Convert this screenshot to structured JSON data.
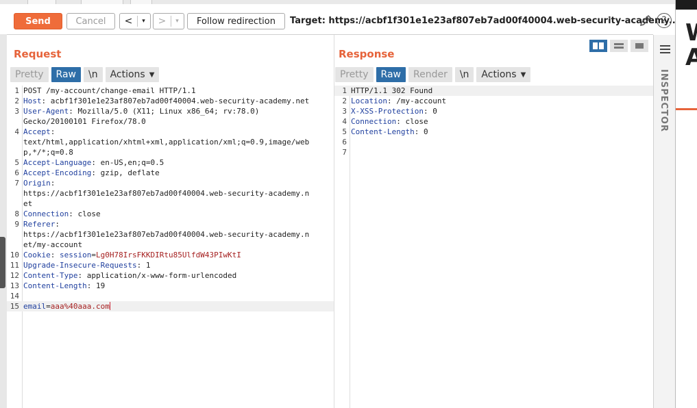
{
  "toolbar": {
    "send_label": "Send",
    "cancel_label": "Cancel",
    "back_label": "<",
    "forward_label": ">",
    "follow_label": "Follow redirection",
    "target_label": "Target: https://acbf1f301e1e23af807eb7ad00f40004.web-security-academy...."
  },
  "request": {
    "title": "Request",
    "tabs": [
      "Pretty",
      "Raw",
      "\\n",
      "Actions"
    ],
    "active_tab": "Raw",
    "lines": [
      {
        "n": "1",
        "key": "",
        "val": "POST /my-account/change-email HTTP/1.1"
      },
      {
        "n": "2",
        "key": "Host",
        "val": "acbf1f301e1e23af807eb7ad00f40004.web-security-academy.net"
      },
      {
        "n": "3",
        "key": "User-Agent",
        "val": "Mozilla/5.0 (X11; Linux x86_64; rv:78.0)"
      },
      {
        "n": "",
        "key": "",
        "val": "Gecko/20100101 Firefox/78.0"
      },
      {
        "n": "4",
        "key": "Accept",
        "val": ""
      },
      {
        "n": "",
        "key": "",
        "val": "text/html,application/xhtml+xml,application/xml;q=0.9,image/web"
      },
      {
        "n": "",
        "key": "",
        "val": "p,*/*;q=0.8"
      },
      {
        "n": "5",
        "key": "Accept-Language",
        "val": "en-US,en;q=0.5"
      },
      {
        "n": "6",
        "key": "Accept-Encoding",
        "val": "gzip, deflate"
      },
      {
        "n": "7",
        "key": "Origin",
        "val": ""
      },
      {
        "n": "",
        "key": "",
        "val": "https://acbf1f301e1e23af807eb7ad00f40004.web-security-academy.n"
      },
      {
        "n": "",
        "key": "",
        "val": "et"
      },
      {
        "n": "8",
        "key": "Connection",
        "val": "close"
      },
      {
        "n": "9",
        "key": "Referer",
        "val": ""
      },
      {
        "n": "",
        "key": "",
        "val": "https://acbf1f301e1e23af807eb7ad00f40004.web-security-academy.n"
      },
      {
        "n": "",
        "key": "",
        "val": "et/my-account"
      },
      {
        "n": "10",
        "key": "Cookie",
        "val": "",
        "cookie_name": "session",
        "cookie_val": "Lg0H78IrsFKKDIRtu85UlfdW43PIwKtI"
      },
      {
        "n": "11",
        "key": "Upgrade-Insecure-Requests",
        "val": "1"
      },
      {
        "n": "12",
        "key": "Content-Type",
        "val": "application/x-www-form-urlencoded"
      },
      {
        "n": "13",
        "key": "Content-Length",
        "val": "19"
      },
      {
        "n": "14",
        "key": "",
        "val": ""
      },
      {
        "n": "15",
        "key": "",
        "val": "",
        "param_name": "email",
        "param_val": "aaa%40aaa.com"
      }
    ]
  },
  "response": {
    "title": "Response",
    "tabs": [
      "Pretty",
      "Raw",
      "Render",
      "\\n",
      "Actions"
    ],
    "active_tab": "Raw",
    "lines": [
      {
        "n": "1",
        "key": "",
        "val": "HTTP/1.1 302 Found"
      },
      {
        "n": "2",
        "key": "Location",
        "val": "/my-account"
      },
      {
        "n": "3",
        "key": "X-XSS-Protection",
        "val": "0"
      },
      {
        "n": "4",
        "key": "Connection",
        "val": "close"
      },
      {
        "n": "5",
        "key": "Content-Length",
        "val": "0"
      },
      {
        "n": "6",
        "key": "",
        "val": ""
      },
      {
        "n": "7",
        "key": "",
        "val": ""
      }
    ]
  },
  "inspector": {
    "label": "INSPECTOR"
  },
  "side": {
    "partial_text": "W\nA"
  },
  "colors": {
    "accent": "#e6633a",
    "tab_active": "#2e6ea8",
    "header_key": "#1f3f9e",
    "cookie_value": "#a51f1f"
  }
}
